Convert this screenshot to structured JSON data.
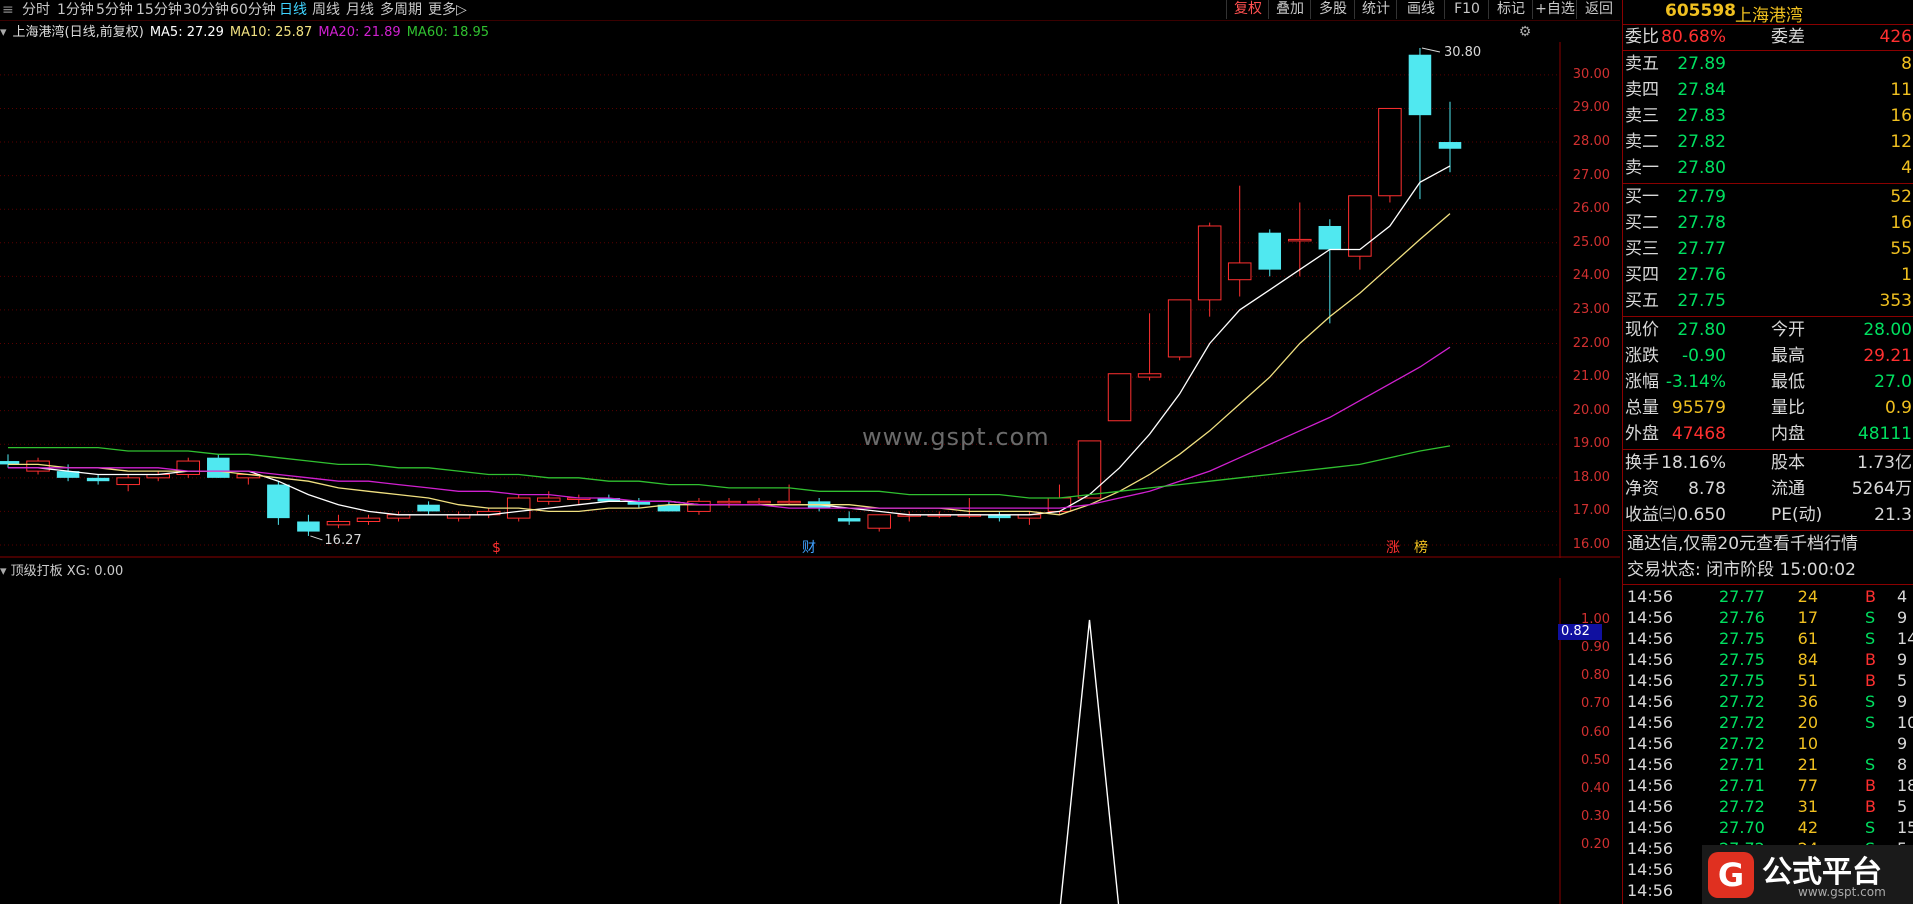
{
  "toolbar": {
    "menu_glyph": "≡",
    "periods": [
      "分时",
      "1分钟",
      "5分钟",
      "15分钟",
      "30分钟",
      "60分钟",
      "日线",
      "周线",
      "月线",
      "多周期",
      "更多▷"
    ],
    "active_period": "日线",
    "right_buttons": [
      "复权",
      "叠加",
      "多股",
      "统计",
      "画线",
      "F10",
      "标记",
      "+自选",
      "返回"
    ],
    "active_right": "复权"
  },
  "chart": {
    "title": "上海港湾(日线,前复权)",
    "ma5_label": "MA5: 27.29",
    "ma10_label": "MA10: 25.87",
    "ma20_label": "MA20: 21.89",
    "ma60_label": "MA60: 18.95",
    "high_label": "30.80",
    "low_label": "16.27",
    "y_ticks": [
      "30.00",
      "29.00",
      "28.00",
      "27.00",
      "26.00",
      "25.00",
      "24.00",
      "23.00",
      "22.00",
      "21.00",
      "20.00",
      "19.00",
      "18.00",
      "17.00",
      "16.00"
    ],
    "markers": [
      {
        "text": "$",
        "color": "#ff3030"
      },
      {
        "text": "财",
        "color": "#3fa0ff"
      },
      {
        "text": "涨",
        "color": "#ff3030"
      },
      {
        "text": "榜",
        "color": "#f0c020"
      }
    ],
    "watermark": "www.gspt.com"
  },
  "sub_chart": {
    "title": "顶级打板 XG: 0.00",
    "y_ticks": [
      "1.00",
      "0.90",
      "0.80",
      "0.70",
      "0.60",
      "0.50",
      "0.40",
      "0.30",
      "0.20"
    ],
    "highlight_value": "0.82"
  },
  "chart_data": {
    "type": "candlestick",
    "ylim": [
      16.0,
      30.8
    ],
    "candles": [
      {
        "o": 18.5,
        "h": 18.7,
        "l": 18.3,
        "c": 18.4
      },
      {
        "o": 18.2,
        "h": 18.6,
        "l": 18.1,
        "c": 18.5
      },
      {
        "o": 18.2,
        "h": 18.4,
        "l": 17.9,
        "c": 18.0
      },
      {
        "o": 18.0,
        "h": 18.1,
        "l": 17.8,
        "c": 17.9
      },
      {
        "o": 17.8,
        "h": 18.1,
        "l": 17.6,
        "c": 18.0
      },
      {
        "o": 18.0,
        "h": 18.2,
        "l": 17.9,
        "c": 18.1
      },
      {
        "o": 18.1,
        "h": 18.6,
        "l": 18.0,
        "c": 18.5
      },
      {
        "o": 18.6,
        "h": 18.7,
        "l": 18.0,
        "c": 18.0
      },
      {
        "o": 18.0,
        "h": 18.1,
        "l": 17.8,
        "c": 18.1
      },
      {
        "o": 17.8,
        "h": 17.9,
        "l": 16.6,
        "c": 16.8
      },
      {
        "o": 16.7,
        "h": 16.9,
        "l": 16.27,
        "c": 16.4
      },
      {
        "o": 16.6,
        "h": 16.9,
        "l": 16.5,
        "c": 16.7
      },
      {
        "o": 16.7,
        "h": 16.9,
        "l": 16.6,
        "c": 16.8
      },
      {
        "o": 16.8,
        "h": 17.0,
        "l": 16.7,
        "c": 16.9
      },
      {
        "o": 17.2,
        "h": 17.3,
        "l": 16.9,
        "c": 17.0
      },
      {
        "o": 16.8,
        "h": 17.0,
        "l": 16.7,
        "c": 16.9
      },
      {
        "o": 16.9,
        "h": 17.1,
        "l": 16.8,
        "c": 17.0
      },
      {
        "o": 16.8,
        "h": 17.5,
        "l": 16.7,
        "c": 17.4
      },
      {
        "o": 17.3,
        "h": 17.6,
        "l": 17.2,
        "c": 17.4
      },
      {
        "o": 17.4,
        "h": 17.5,
        "l": 17.2,
        "c": 17.4
      },
      {
        "o": 17.4,
        "h": 17.5,
        "l": 17.3,
        "c": 17.3
      },
      {
        "o": 17.3,
        "h": 17.4,
        "l": 17.1,
        "c": 17.2
      },
      {
        "o": 17.2,
        "h": 17.3,
        "l": 17.0,
        "c": 17.0
      },
      {
        "o": 17.0,
        "h": 17.4,
        "l": 16.9,
        "c": 17.3
      },
      {
        "o": 17.3,
        "h": 17.4,
        "l": 17.1,
        "c": 17.3
      },
      {
        "o": 17.3,
        "h": 17.4,
        "l": 17.2,
        "c": 17.3
      },
      {
        "o": 17.3,
        "h": 17.8,
        "l": 17.2,
        "c": 17.3
      },
      {
        "o": 17.3,
        "h": 17.4,
        "l": 17.0,
        "c": 17.1
      },
      {
        "o": 16.8,
        "h": 17.0,
        "l": 16.6,
        "c": 16.7
      },
      {
        "o": 16.5,
        "h": 16.9,
        "l": 16.4,
        "c": 16.9
      },
      {
        "o": 16.9,
        "h": 17.0,
        "l": 16.7,
        "c": 16.9
      },
      {
        "o": 16.9,
        "h": 17.0,
        "l": 16.8,
        "c": 16.9
      },
      {
        "o": 16.9,
        "h": 17.4,
        "l": 16.8,
        "c": 16.9
      },
      {
        "o": 16.9,
        "h": 17.0,
        "l": 16.7,
        "c": 16.8
      },
      {
        "o": 16.8,
        "h": 17.0,
        "l": 16.6,
        "c": 16.9
      },
      {
        "o": 17.0,
        "h": 17.8,
        "l": 16.9,
        "c": 17.4
      },
      {
        "o": 17.4,
        "h": 19.1,
        "l": 17.4,
        "c": 19.1
      },
      {
        "o": 19.7,
        "h": 21.1,
        "l": 19.7,
        "c": 21.1
      },
      {
        "o": 21.0,
        "h": 22.9,
        "l": 20.9,
        "c": 21.1
      },
      {
        "o": 21.6,
        "h": 23.3,
        "l": 21.5,
        "c": 23.3
      },
      {
        "o": 23.3,
        "h": 25.6,
        "l": 22.8,
        "c": 25.5
      },
      {
        "o": 23.9,
        "h": 26.7,
        "l": 23.4,
        "c": 24.4
      },
      {
        "o": 25.3,
        "h": 25.4,
        "l": 24.0,
        "c": 24.2
      },
      {
        "o": 25.1,
        "h": 26.2,
        "l": 24.0,
        "c": 25.1
      },
      {
        "o": 25.5,
        "h": 25.7,
        "l": 22.6,
        "c": 24.8
      },
      {
        "o": 24.6,
        "h": 26.4,
        "l": 24.2,
        "c": 26.4
      },
      {
        "o": 26.4,
        "h": 28.0,
        "l": 26.2,
        "c": 29.0
      },
      {
        "o": 30.6,
        "h": 30.8,
        "l": 26.3,
        "c": 28.8
      },
      {
        "o": 28.0,
        "h": 29.2,
        "l": 27.1,
        "c": 27.8
      }
    ],
    "ma_series": [
      {
        "name": "MA5",
        "color": "#ffffff",
        "values": [
          18.3,
          18.3,
          18.2,
          18.1,
          18.1,
          18.1,
          18.2,
          18.2,
          18.2,
          17.9,
          17.5,
          17.2,
          17.0,
          16.9,
          16.9,
          16.9,
          16.9,
          17.0,
          17.1,
          17.2,
          17.3,
          17.3,
          17.3,
          17.2,
          17.2,
          17.2,
          17.2,
          17.2,
          17.1,
          17.0,
          16.9,
          16.9,
          16.9,
          16.9,
          16.9,
          17.0,
          17.5,
          18.3,
          19.3,
          20.5,
          22.0,
          23.0,
          23.6,
          24.2,
          24.8,
          24.8,
          25.5,
          26.8,
          27.29
        ]
      },
      {
        "name": "MA10",
        "color": "#f0e080",
        "values": [
          18.4,
          18.4,
          18.3,
          18.3,
          18.2,
          18.2,
          18.2,
          18.2,
          18.1,
          18.0,
          17.9,
          17.7,
          17.6,
          17.5,
          17.4,
          17.2,
          17.1,
          17.1,
          17.0,
          17.0,
          17.1,
          17.1,
          17.2,
          17.2,
          17.2,
          17.2,
          17.2,
          17.2,
          17.2,
          17.1,
          17.1,
          17.1,
          17.0,
          17.0,
          17.0,
          16.9,
          17.2,
          17.6,
          18.1,
          18.7,
          19.4,
          20.2,
          21.0,
          22.0,
          22.8,
          23.5,
          24.3,
          25.1,
          25.87
        ]
      },
      {
        "name": "MA20",
        "color": "#d020d0",
        "values": [
          18.3,
          18.3,
          18.3,
          18.3,
          18.3,
          18.3,
          18.2,
          18.2,
          18.2,
          18.1,
          18.0,
          17.9,
          17.9,
          17.8,
          17.7,
          17.6,
          17.6,
          17.5,
          17.5,
          17.4,
          17.4,
          17.3,
          17.3,
          17.2,
          17.2,
          17.2,
          17.1,
          17.1,
          17.1,
          17.1,
          17.1,
          17.1,
          17.1,
          17.1,
          17.1,
          17.1,
          17.2,
          17.4,
          17.6,
          17.9,
          18.2,
          18.6,
          19.0,
          19.4,
          19.8,
          20.3,
          20.8,
          21.3,
          21.89
        ]
      },
      {
        "name": "MA60",
        "color": "#30c030",
        "values": [
          18.9,
          18.9,
          18.9,
          18.9,
          18.8,
          18.8,
          18.8,
          18.7,
          18.7,
          18.6,
          18.5,
          18.4,
          18.4,
          18.3,
          18.3,
          18.2,
          18.1,
          18.1,
          18.0,
          18.0,
          17.9,
          17.9,
          17.8,
          17.8,
          17.7,
          17.7,
          17.7,
          17.6,
          17.6,
          17.6,
          17.5,
          17.5,
          17.5,
          17.5,
          17.4,
          17.4,
          17.5,
          17.6,
          17.7,
          17.8,
          17.9,
          18.0,
          18.1,
          18.2,
          18.3,
          18.4,
          18.6,
          18.8,
          18.95
        ]
      }
    ],
    "indicator": {
      "peak_index": 36,
      "peak_value": 1.0
    }
  },
  "panel": {
    "code": "605598",
    "name": "上海港湾",
    "weibi": {
      "label": "委比",
      "value": "80.68%",
      "label2": "委差",
      "value2": "426"
    },
    "asks": [
      {
        "label": "卖五",
        "price": "27.89",
        "vol": "8"
      },
      {
        "label": "卖四",
        "price": "27.84",
        "vol": "11"
      },
      {
        "label": "卖三",
        "price": "27.83",
        "vol": "16"
      },
      {
        "label": "卖二",
        "price": "27.82",
        "vol": "12"
      },
      {
        "label": "卖一",
        "price": "27.80",
        "vol": "4"
      }
    ],
    "bids": [
      {
        "label": "买一",
        "price": "27.79",
        "vol": "52"
      },
      {
        "label": "买二",
        "price": "27.78",
        "vol": "16"
      },
      {
        "label": "买三",
        "price": "27.77",
        "vol": "55"
      },
      {
        "label": "买四",
        "price": "27.76",
        "vol": "1"
      },
      {
        "label": "买五",
        "price": "27.75",
        "vol": "353"
      }
    ],
    "stats": [
      {
        "a": "现价",
        "b": "27.80",
        "bc": "#00e060",
        "c": "今开",
        "d": "28.00",
        "dc": "#00e060"
      },
      {
        "a": "涨跌",
        "b": "-0.90",
        "bc": "#00e060",
        "c": "最高",
        "d": "29.21",
        "dc": "#ff3030"
      },
      {
        "a": "涨幅",
        "b": "-3.14%",
        "bc": "#00e060",
        "c": "最低",
        "d": "27.0",
        "dc": "#00e060"
      },
      {
        "a": "总量",
        "b": "95579",
        "bc": "#f0c020",
        "c": "量比",
        "d": "0.9",
        "dc": "#f0c020"
      },
      {
        "a": "外盘",
        "b": "47468",
        "bc": "#ff3030",
        "c": "内盘",
        "d": "48111",
        "dc": "#00e060"
      }
    ],
    "stats2": [
      {
        "a": "换手",
        "b": "18.16%",
        "c": "股本",
        "d": "1.73亿"
      },
      {
        "a": "净资",
        "b": "8.78",
        "c": "流通",
        "d": "5264万"
      },
      {
        "a": "收益㈢",
        "b": "0.650",
        "c": "PE(动)",
        "d": "21.3"
      }
    ],
    "promo": "通达信,仅需20元查看千档行情",
    "trade_status": "交易状态: 闭市阶段 15:00:02",
    "ticks": [
      {
        "t": "14:56",
        "p": "27.77",
        "pc": "#00e060",
        "v": "24",
        "bs": "B",
        "n": "4"
      },
      {
        "t": "14:56",
        "p": "27.76",
        "pc": "#00e060",
        "v": "17",
        "bs": "S",
        "n": "9"
      },
      {
        "t": "14:56",
        "p": "27.75",
        "pc": "#00e060",
        "v": "61",
        "bs": "S",
        "n": "14"
      },
      {
        "t": "14:56",
        "p": "27.75",
        "pc": "#00e060",
        "v": "84",
        "bs": "B",
        "n": "9"
      },
      {
        "t": "14:56",
        "p": "27.75",
        "pc": "#00e060",
        "v": "51",
        "bs": "B",
        "n": "5"
      },
      {
        "t": "14:56",
        "p": "27.72",
        "pc": "#00e060",
        "v": "36",
        "bs": "S",
        "n": "9"
      },
      {
        "t": "14:56",
        "p": "27.72",
        "pc": "#00e060",
        "v": "20",
        "bs": "S",
        "n": "10"
      },
      {
        "t": "14:56",
        "p": "27.72",
        "pc": "#00e060",
        "v": "10",
        "bs": "",
        "n": "9"
      },
      {
        "t": "14:56",
        "p": "27.71",
        "pc": "#00e060",
        "v": "21",
        "bs": "S",
        "n": "8"
      },
      {
        "t": "14:56",
        "p": "27.71",
        "pc": "#00e060",
        "v": "77",
        "bs": "B",
        "n": "18"
      },
      {
        "t": "14:56",
        "p": "27.72",
        "pc": "#00e060",
        "v": "31",
        "bs": "B",
        "n": "5"
      },
      {
        "t": "14:56",
        "p": "27.70",
        "pc": "#00e060",
        "v": "42",
        "bs": "S",
        "n": "15"
      },
      {
        "t": "14:56",
        "p": "27.72",
        "pc": "#00e060",
        "v": "24",
        "bs": "S",
        "n": "5"
      },
      {
        "t": "14:56",
        "p": "",
        "pc": "#00e060",
        "v": "",
        "bs": "",
        "n": ""
      },
      {
        "t": "14:56",
        "p": "",
        "pc": "#00e060",
        "v": "",
        "bs": "",
        "n": ""
      }
    ],
    "logo": {
      "glyph": "G",
      "text": "公式平台",
      "url": "www.gspt.com"
    }
  },
  "colors": {
    "up": "#ff3030",
    "down": "#50e8f0",
    "grid": "#5a0000"
  }
}
